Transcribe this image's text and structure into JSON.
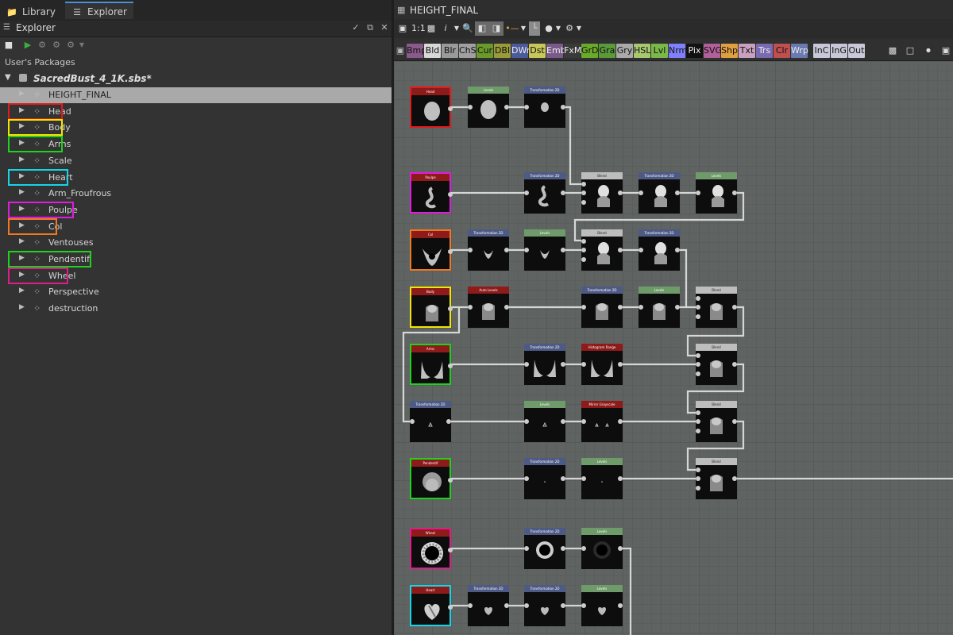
{
  "left_panel": {
    "tabs": [
      {
        "label": "Library",
        "icon": "folder-icon"
      },
      {
        "label": "Explorer",
        "icon": "explorer-tree-icon"
      }
    ],
    "explorer_title": "Explorer",
    "section_label": "User's Packages",
    "package": {
      "name": "SacredBust_4_1K.sbs*"
    },
    "graphs": [
      {
        "label": "HEIGHT_FINAL",
        "selected": true,
        "highlight": ""
      },
      {
        "label": "Head",
        "highlight": "#e01c1c"
      },
      {
        "label": "Body",
        "highlight": "#f2e600"
      },
      {
        "label": "Arms",
        "highlight": "#1ed21e"
      },
      {
        "label": "Scale",
        "highlight": ""
      },
      {
        "label": "Heart",
        "highlight": "#14d6e6"
      },
      {
        "label": "Arm_Froufrous",
        "highlight": ""
      },
      {
        "label": "Poulpe",
        "highlight": "#e01ce0"
      },
      {
        "label": "Col",
        "highlight": "#f07820"
      },
      {
        "label": "Ventouses",
        "highlight": ""
      },
      {
        "label": "Pendentif",
        "highlight": "#1ed21e"
      },
      {
        "label": "Wheel",
        "highlight": "#e01c8a"
      },
      {
        "label": "Perspective",
        "highlight": ""
      },
      {
        "label": "destruction",
        "highlight": ""
      }
    ]
  },
  "graph_view": {
    "title": "HEIGHT_FINAL",
    "zoom_label": "1:1",
    "info_label": "i",
    "atomic_nodes": [
      {
        "label": "Bmp",
        "color": "#8a5a8a"
      },
      {
        "label": "Bld",
        "color": "#d8d8d8"
      },
      {
        "label": "Blr",
        "color": "#9a9a9a"
      },
      {
        "label": "ChS",
        "color": "#a0a0a0"
      },
      {
        "label": "Cur",
        "color": "#6a9a2a"
      },
      {
        "label": "DBl",
        "color": "#9a9a3a"
      },
      {
        "label": "DWr",
        "color": "#4a5a9a"
      },
      {
        "label": "Dst",
        "color": "#c8c85a"
      },
      {
        "label": "Emb",
        "color": "#7a5a8a"
      },
      {
        "label": "FxM",
        "color": "#3a3a3a"
      },
      {
        "label": "GrD",
        "color": "#6aaa2a"
      },
      {
        "label": "Gra",
        "color": "#5a9a3a"
      },
      {
        "label": "Gry",
        "color": "#aaaaaa"
      },
      {
        "label": "HSL",
        "color": "#a8c870"
      },
      {
        "label": "Lvl",
        "color": "#7ab84a"
      },
      {
        "label": "Nrm",
        "color": "#8080ff"
      },
      {
        "label": "Pix",
        "color": "#111111"
      },
      {
        "label": "SVG",
        "color": "#b0609a"
      },
      {
        "label": "Shp",
        "color": "#e0a040"
      },
      {
        "label": "Txt",
        "color": "#c8a0c0"
      },
      {
        "label": "Trs",
        "color": "#7a6ab0"
      },
      {
        "label": "Clr",
        "color": "#c05050"
      },
      {
        "label": "Wrp",
        "color": "#6a7ab0"
      },
      {
        "label": "InC",
        "color": "#c8c8d8"
      },
      {
        "label": "InG",
        "color": "#c8c8d8"
      },
      {
        "label": "Out",
        "color": "#c8c8d8"
      }
    ],
    "nodes": [
      {
        "id": "head",
        "label": "Head",
        "kind": "input",
        "frame": "#e01c1c"
      },
      {
        "id": "levels-1",
        "label": "Levels",
        "kind": "levels"
      },
      {
        "id": "transform-1",
        "label": "Transformation 2D",
        "kind": "transform"
      },
      {
        "id": "poulpe",
        "label": "Poulpe",
        "kind": "input",
        "frame": "#e01ce0"
      },
      {
        "id": "transform-2",
        "label": "Transformation 2D",
        "kind": "transform"
      },
      {
        "id": "blend-1",
        "label": "Blend",
        "kind": "blend"
      },
      {
        "id": "transform-3",
        "label": "Transformation 2D",
        "kind": "transform"
      },
      {
        "id": "levels-2",
        "label": "Levels",
        "kind": "levels"
      },
      {
        "id": "col",
        "label": "Col",
        "kind": "input",
        "frame": "#f07820"
      },
      {
        "id": "transform-4",
        "label": "Transformation 2D",
        "kind": "transform"
      },
      {
        "id": "levels-3",
        "label": "Levels",
        "kind": "levels"
      },
      {
        "id": "blend-2",
        "label": "Blend",
        "kind": "blend"
      },
      {
        "id": "transform-5",
        "label": "Transformation 2D",
        "kind": "transform"
      },
      {
        "id": "body",
        "label": "Body",
        "kind": "input",
        "frame": "#f2e600"
      },
      {
        "id": "autolevels",
        "label": "Auto Levels",
        "kind": "input"
      },
      {
        "id": "transform-6",
        "label": "Transformation 2D",
        "kind": "transform"
      },
      {
        "id": "levels-4",
        "label": "Levels",
        "kind": "levels"
      },
      {
        "id": "blend-3",
        "label": "Blend",
        "kind": "blend"
      },
      {
        "id": "arms",
        "label": "Arms",
        "kind": "input",
        "frame": "#1ed21e"
      },
      {
        "id": "transform-7",
        "label": "Transformation 2D",
        "kind": "transform"
      },
      {
        "id": "histogram-range",
        "label": "Histogram Range",
        "kind": "input"
      },
      {
        "id": "blend-4",
        "label": "Blend",
        "kind": "blend"
      },
      {
        "id": "transform-8",
        "label": "Transformation 2D",
        "kind": "transform"
      },
      {
        "id": "levels-5",
        "label": "Levels",
        "kind": "levels"
      },
      {
        "id": "mirror",
        "label": "Mirror Grayscale",
        "kind": "input"
      },
      {
        "id": "blend-5",
        "label": "Blend",
        "kind": "blend"
      },
      {
        "id": "pendentif",
        "label": "Pendentif",
        "kind": "input",
        "frame": "#1ed21e"
      },
      {
        "id": "transform-9",
        "label": "Transformation 2D",
        "kind": "transform"
      },
      {
        "id": "levels-6",
        "label": "Levels",
        "kind": "levels"
      },
      {
        "id": "blend-6",
        "label": "Blend",
        "kind": "blend"
      },
      {
        "id": "wheel",
        "label": "Wheel",
        "kind": "input",
        "frame": "#e01c8a"
      },
      {
        "id": "transform-10",
        "label": "Transformation 2D",
        "kind": "transform"
      },
      {
        "id": "levels-7",
        "label": "Levels",
        "kind": "levels"
      },
      {
        "id": "heart",
        "label": "Heart",
        "kind": "input",
        "frame": "#14d6e6"
      },
      {
        "id": "transform-11",
        "label": "Transformation 2D",
        "kind": "transform"
      },
      {
        "id": "transform-12",
        "label": "Transformation 2D",
        "kind": "transform"
      },
      {
        "id": "levels-8",
        "label": "Levels",
        "kind": "levels"
      }
    ],
    "header_colors": {
      "input": "#8e1a1a",
      "levels": "#6f9a6a",
      "transform": "#4e5a86",
      "blend": "#bdbdbd"
    }
  }
}
